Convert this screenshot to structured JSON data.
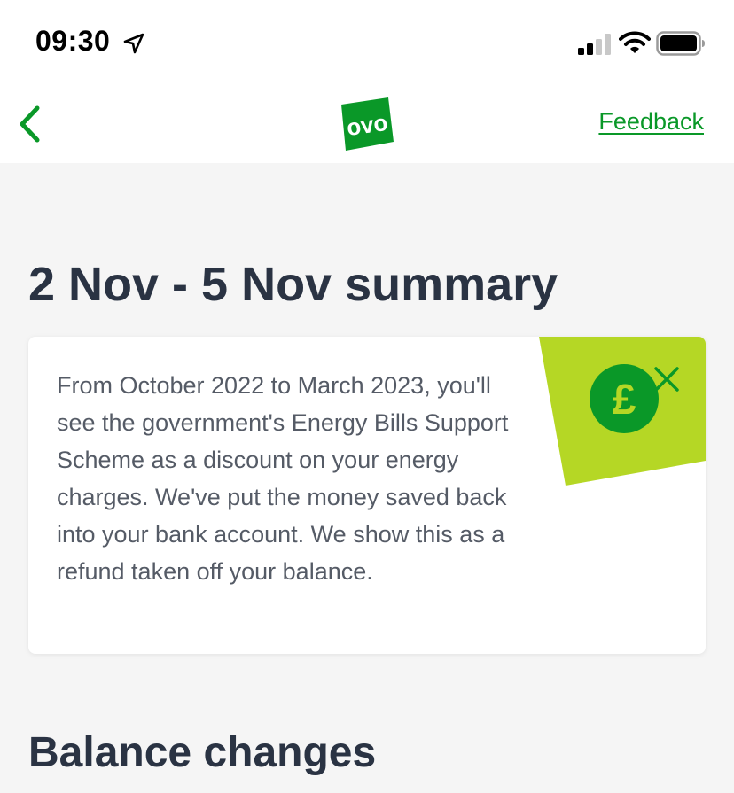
{
  "status_bar": {
    "time": "09:30",
    "icons": [
      "location-icon",
      "signal-icon",
      "wifi-icon",
      "battery-icon"
    ]
  },
  "header": {
    "back_icon": "chevron-left-icon",
    "logo_text": "ovo",
    "feedback_label": "Feedback"
  },
  "summary": {
    "title": "2 Nov - 5 Nov summary"
  },
  "notice_card": {
    "text": "From October 2022 to March 2023, you'll see the government's Energy Bills Support Scheme as a discount on your energy charges. We've put the money saved back into your bank account. We show this as a refund taken off your balance.",
    "badge_icon": "pound-icon",
    "close_icon": "close-icon"
  },
  "balance": {
    "title": "Balance changes"
  },
  "colors": {
    "brand_green": "#0a9828",
    "lime_accent": "#b5d725",
    "heading": "#2a3343",
    "body_text": "#555b66",
    "background": "#f5f5f5"
  }
}
